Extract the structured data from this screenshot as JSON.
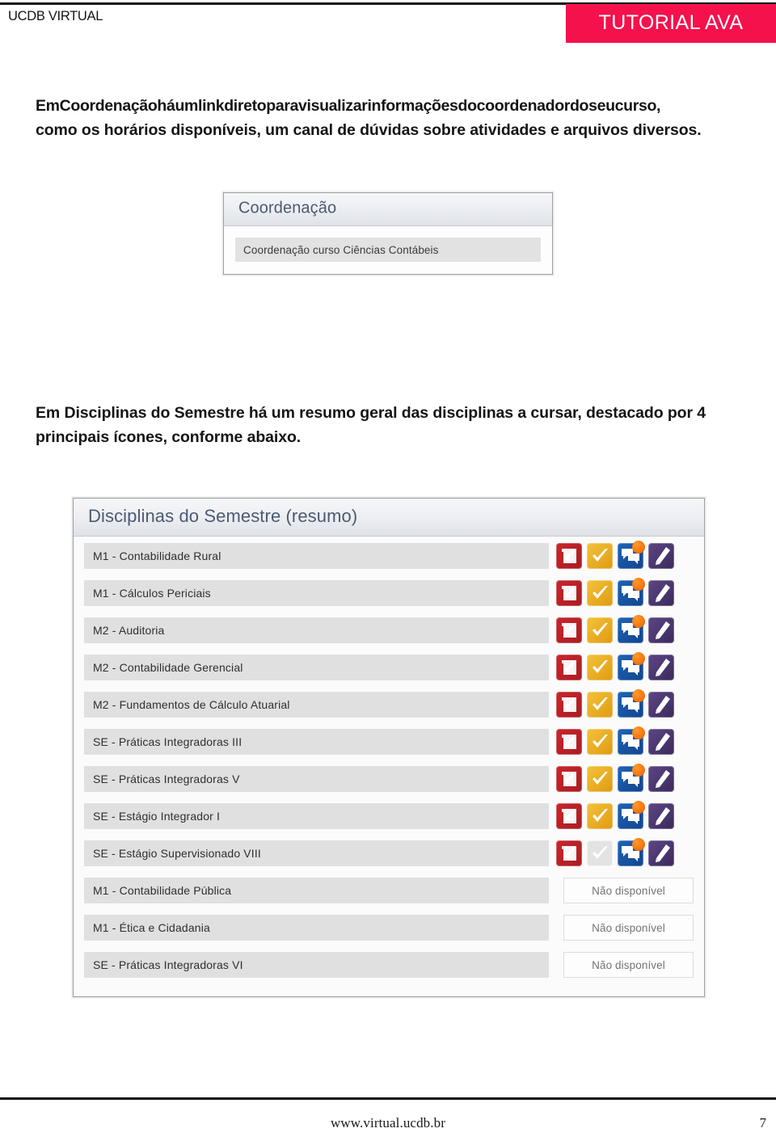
{
  "header": {
    "brand": "UCDB VIRTUAL",
    "banner_label": "TUTORIAL AVA",
    "banner_color": "#f4114c"
  },
  "paragraphs": {
    "p1_line1": "EmCoordenaçãoháumlinkdiretoparavisualizarinformaçõesdocoordenadordoseucurso,",
    "p1_line2": "como os horários disponíveis, um canal de dúvidas sobre atividades e arquivos diversos.",
    "p2_line1": "Em Disciplinas do Semestre há um resumo geral das disciplinas a cursar, destacado por 4",
    "p2_line2": "principais ícones, conforme abaixo."
  },
  "coordenacao_panel": {
    "title": "Coordenação",
    "rows": [
      {
        "label": "Coordenação curso Ciências Contábeis"
      }
    ]
  },
  "disciplinas_panel": {
    "title": "Disciplinas do Semestre (resumo)",
    "unavailable_label": "Não disponível",
    "icons": {
      "red": "download-arrow-icon",
      "yellow": "checkmark-icon",
      "blue": "forum-bubble-icon",
      "purple": "pencil-edit-icon",
      "red_color": "#c9262c",
      "yellow_color": "#f3c33a",
      "blue_color": "#1f63b8",
      "purple_color": "#5c4685",
      "badge_color": "#f26a0a",
      "disabled_color": "#e3e3e3"
    },
    "rows": [
      {
        "label": "M1 - Contabilidade Rural",
        "state": "icons",
        "check_enabled": true,
        "badge": true
      },
      {
        "label": "M1 - Cálculos Periciais",
        "state": "icons",
        "check_enabled": true,
        "badge": true
      },
      {
        "label": "M2 - Auditoria",
        "state": "icons",
        "check_enabled": true,
        "badge": true
      },
      {
        "label": "M2 - Contabilidade Gerencial",
        "state": "icons",
        "check_enabled": true,
        "badge": true
      },
      {
        "label": "M2 - Fundamentos de Cálculo Atuarial",
        "state": "icons",
        "check_enabled": true,
        "badge": true
      },
      {
        "label": "SE - Práticas Integradoras III",
        "state": "icons",
        "check_enabled": true,
        "badge": true
      },
      {
        "label": "SE - Práticas Integradoras V",
        "state": "icons",
        "check_enabled": true,
        "badge": true
      },
      {
        "label": "SE - Estágio Integrador I",
        "state": "icons",
        "check_enabled": true,
        "badge": true
      },
      {
        "label": "SE - Estágio Supervisionado VIII",
        "state": "icons",
        "check_enabled": false,
        "badge": true
      },
      {
        "label": "M1 - Contabilidade Pública",
        "state": "unavailable",
        "check_enabled": false,
        "badge": false
      },
      {
        "label": "M1 - Ética e Cidadania",
        "state": "unavailable",
        "check_enabled": false,
        "badge": false
      },
      {
        "label": "SE - Práticas Integradoras VI",
        "state": "unavailable",
        "check_enabled": false,
        "badge": false
      }
    ]
  },
  "footer": {
    "url": "www.virtual.ucdb.br",
    "page_number": "7"
  }
}
